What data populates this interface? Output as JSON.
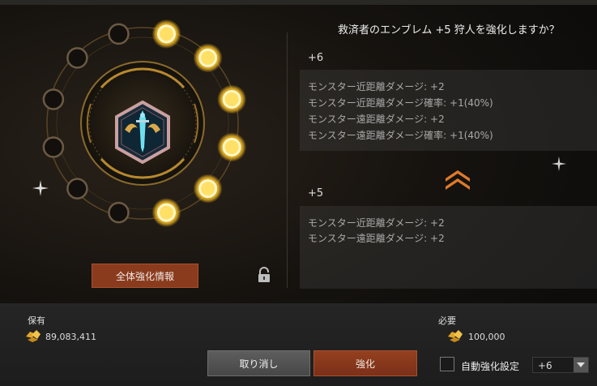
{
  "dialog": {
    "question": "救済者のエンブレム +5 狩人を強化しますか？"
  },
  "next_level": {
    "label": "+6",
    "stats": [
      "モンスター近距離ダメージ: +2",
      "モンスター近距離ダメージ確率: +1(40%)",
      "モンスター遠距離ダメージ: +2",
      "モンスター遠距離ダメージ確率: +1(40%)"
    ]
  },
  "current_level": {
    "label": "+5",
    "stats": [
      "モンスター近距離ダメージ: +2",
      "モンスター遠距離ダメージ: +2"
    ]
  },
  "ring": {
    "lit_slots": 6,
    "total_slots": 12
  },
  "buttons": {
    "info": "全体強化情報",
    "cancel": "取り消し",
    "enhance": "強化"
  },
  "owned": {
    "label": "保有",
    "amount": "89,083,411",
    "icon": "gold-ore-icon"
  },
  "required": {
    "label": "必要",
    "amount": "100,000",
    "icon": "gold-ore-icon"
  },
  "auto": {
    "label": "自動強化設定",
    "checked": false,
    "selected": "+6"
  },
  "colors": {
    "accent_orange": "#8a3b1e",
    "slot_lit": "#ffe066",
    "chevron": "#e07a2a"
  }
}
